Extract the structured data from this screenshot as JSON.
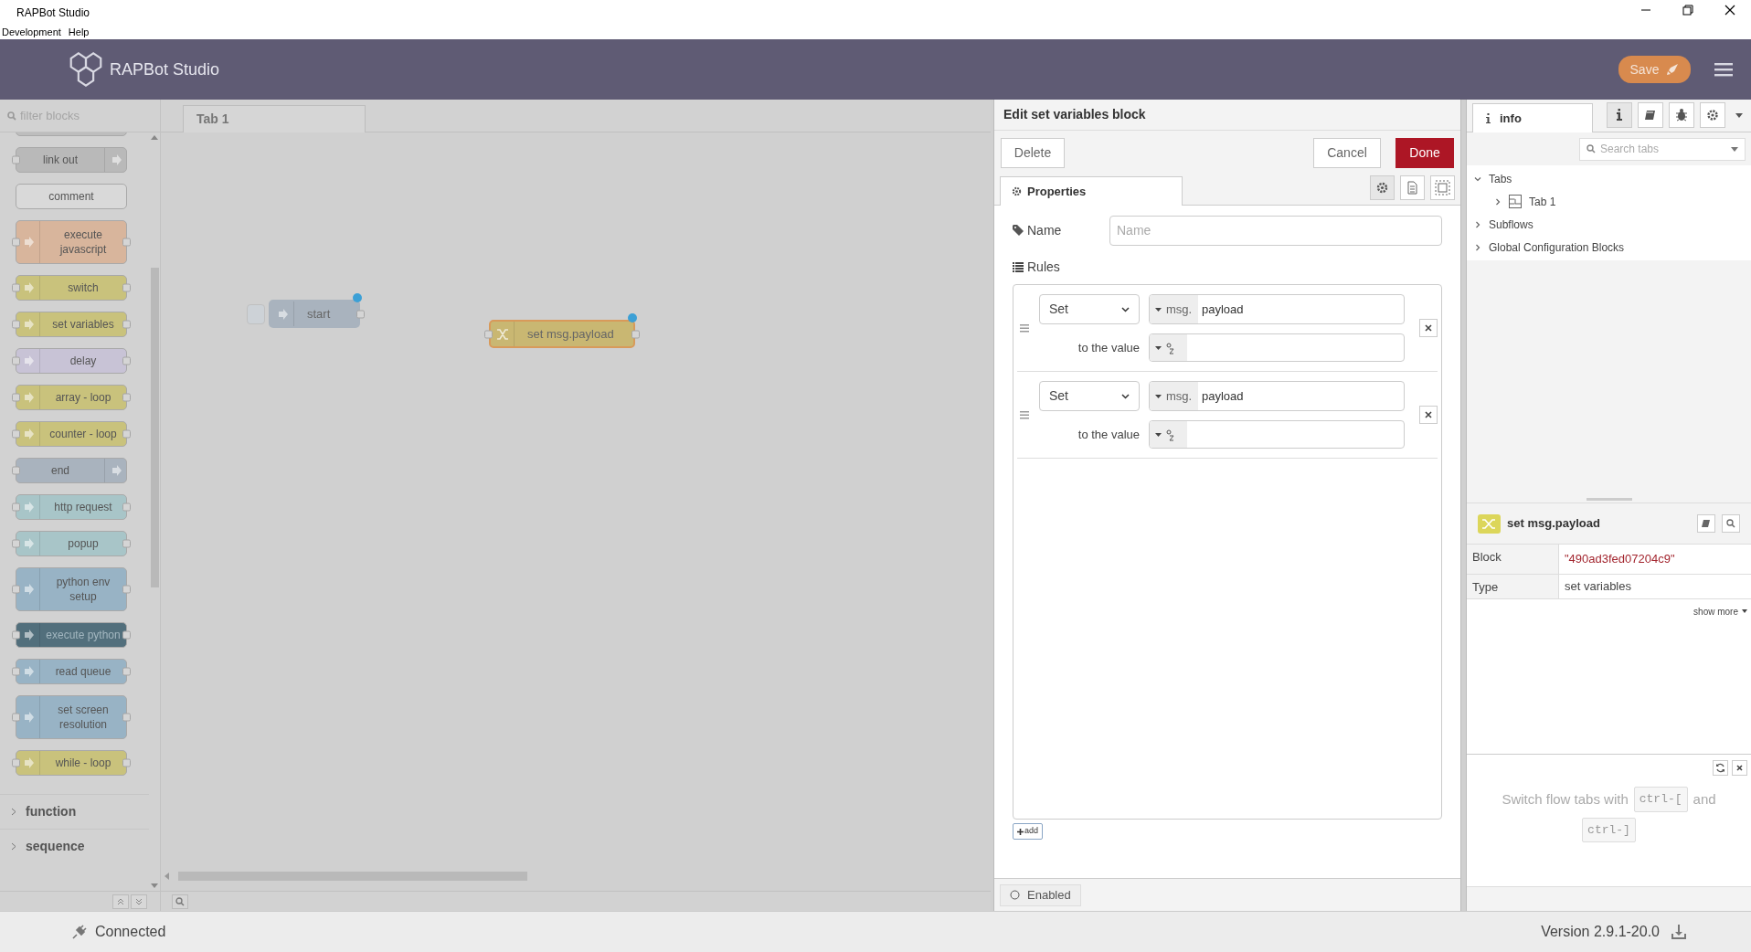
{
  "window": {
    "title": "RAPBot Studio"
  },
  "menu": [
    "Development",
    "Help"
  ],
  "header": {
    "brand": "RAPBot Studio",
    "save_button": "Save"
  },
  "palette": {
    "filter_placeholder": "filter blocks",
    "blocks": [
      {
        "kind": "partial",
        "color": "#bdbdbd"
      },
      {
        "label": "link out",
        "kind": "terminal",
        "color": "#b9b9b9"
      },
      {
        "label": "comment",
        "kind": "note",
        "color": "#d9d9d9"
      },
      {
        "label": "execute javascript",
        "kind": "flow",
        "color": "#d8b59c"
      },
      {
        "label": "switch",
        "kind": "flow",
        "color": "#c9c27c"
      },
      {
        "label": "set variables",
        "kind": "flow",
        "color": "#c9c27c"
      },
      {
        "label": "delay",
        "kind": "flow",
        "color": "#c8c3d6"
      },
      {
        "label": "array - loop",
        "kind": "flow",
        "color": "#c9c27c"
      },
      {
        "label": "counter - loop",
        "kind": "flow",
        "color": "#c9c27c"
      },
      {
        "label": "end",
        "kind": "terminal",
        "color": "#a9b3be"
      },
      {
        "label": "http request",
        "kind": "flow",
        "color": "#a8c5c8"
      },
      {
        "label": "popup",
        "kind": "flow",
        "color": "#a8c5c8"
      },
      {
        "label": "python env setup",
        "kind": "flow",
        "color": "#98b3c5"
      },
      {
        "label": "execute python",
        "kind": "flow",
        "color": "#526f7c"
      },
      {
        "label": "read queue",
        "kind": "flow",
        "color": "#98b3c5"
      },
      {
        "label": "set screen resolution",
        "kind": "flow",
        "color": "#98b3c5"
      },
      {
        "label": "while - loop",
        "kind": "flow",
        "color": "#c9c27c"
      }
    ],
    "categories": [
      {
        "label": "function",
        "expanded": false
      },
      {
        "label": "sequence",
        "expanded": false
      }
    ]
  },
  "workspace": {
    "tabs": [
      {
        "label": "Tab 1",
        "selected": true
      }
    ],
    "nodes": [
      {
        "label": "start",
        "kind": "inject",
        "color": "#a9b3be",
        "changed": true,
        "selected": false
      },
      {
        "label": "set msg.payload",
        "kind": "change",
        "color": "#c9b772",
        "changed": true,
        "selected": true
      }
    ]
  },
  "editor": {
    "title": "Edit set variables block",
    "delete": "Delete",
    "cancel": "Cancel",
    "done": "Done",
    "tabs": [
      {
        "label": "Properties",
        "selected": true
      }
    ],
    "name_label": "Name",
    "name_placeholder": "Name",
    "rules_label": "Rules",
    "rules": [
      {
        "action": "Set",
        "target_prefix": "msg.",
        "target": "payload",
        "value_label": "to the value"
      },
      {
        "action": "Set",
        "target_prefix": "msg.",
        "target": "payload",
        "value_label": "to the value"
      }
    ],
    "add_button": "add",
    "enabled_label": "Enabled"
  },
  "sidebar": {
    "tabs": [
      {
        "label": "info",
        "selected": true
      }
    ],
    "search_placeholder": "Search tabs",
    "tree": [
      {
        "label": "Tabs",
        "expanded": true,
        "children": [
          {
            "label": "Tab 1",
            "expanded": false
          }
        ]
      },
      {
        "label": "Subflows",
        "expanded": false
      },
      {
        "label": "Global Configuration Blocks",
        "expanded": false
      }
    ],
    "node_info": {
      "title": "set msg.payload",
      "properties": [
        {
          "key": "Block",
          "value": "\"490ad3fed07204c9\""
        },
        {
          "key": "Type",
          "value": "set variables"
        }
      ],
      "show_more": "show more"
    },
    "tip": [
      {
        "kind": "text",
        "text": "Switch flow tabs with"
      },
      {
        "kind": "key",
        "text": "ctrl-["
      },
      {
        "kind": "text",
        "text": "and"
      },
      {
        "kind": "key",
        "text": "ctrl-]"
      }
    ]
  },
  "status_bar": {
    "connection": "Connected",
    "version": "Version 2.9.1-20.0"
  }
}
